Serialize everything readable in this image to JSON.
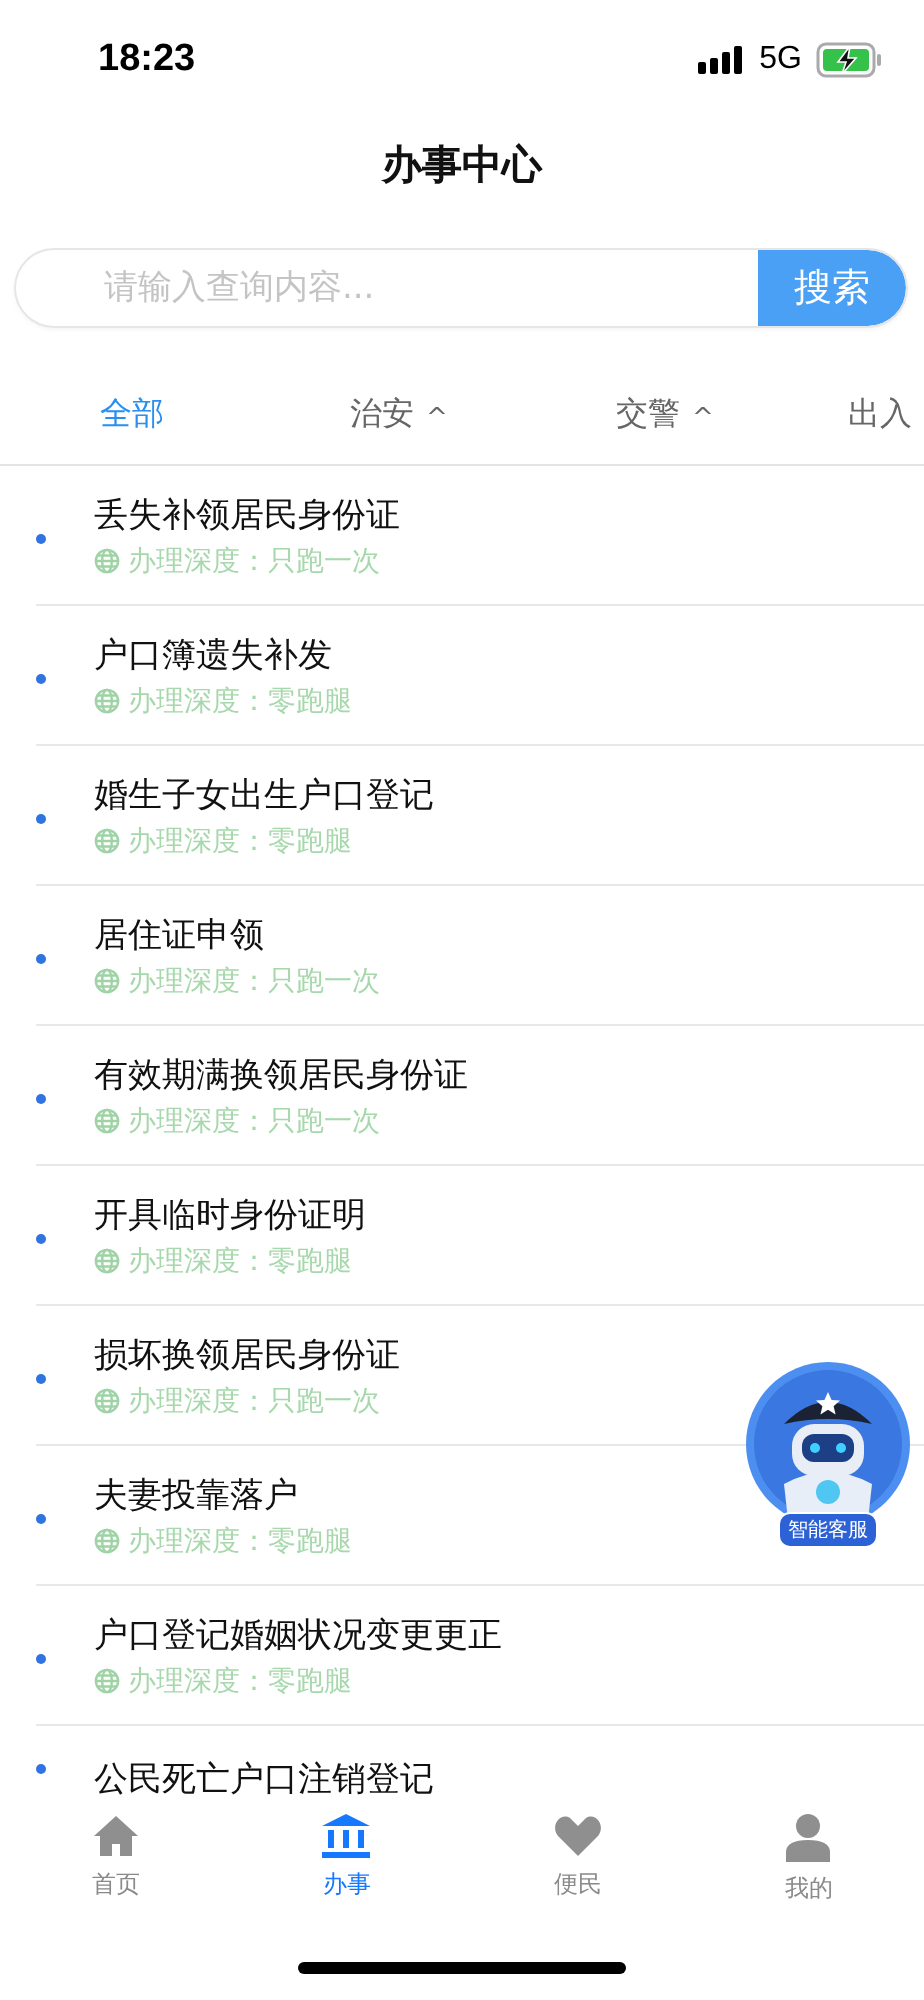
{
  "status_bar": {
    "time": "18:23",
    "network": "5G"
  },
  "header": {
    "title": "办事中心"
  },
  "search": {
    "placeholder": "请输入查询内容...",
    "button": "搜索"
  },
  "filters": [
    {
      "label": "全部",
      "selected": true,
      "has_menu": false
    },
    {
      "label": "治安",
      "selected": false,
      "has_menu": true
    },
    {
      "label": "交警",
      "selected": false,
      "has_menu": true
    },
    {
      "label": "出入",
      "selected": false,
      "has_menu": false
    }
  ],
  "caret": "^",
  "services": [
    {
      "title": "丢失补领居民身份证",
      "depth": "办理深度：只跑一次"
    },
    {
      "title": "户口簿遗失补发",
      "depth": "办理深度：零跑腿"
    },
    {
      "title": "婚生子女出生户口登记",
      "depth": "办理深度：零跑腿"
    },
    {
      "title": "居住证申领",
      "depth": "办理深度：只跑一次"
    },
    {
      "title": "有效期满换领居民身份证",
      "depth": "办理深度：只跑一次"
    },
    {
      "title": "开具临时身份证明",
      "depth": "办理深度：零跑腿"
    },
    {
      "title": "损坏换领居民身份证",
      "depth": "办理深度：只跑一次"
    },
    {
      "title": "夫妻投靠落户",
      "depth": "办理深度：零跑腿"
    },
    {
      "title": "户口登记婚姻状况变更更正",
      "depth": "办理深度：零跑腿"
    },
    {
      "title": "公民死亡户口注销登记"
    }
  ],
  "assistant": {
    "label": "智能客服"
  },
  "tab_bar": [
    {
      "label": "首页",
      "kind": "home",
      "selected": false
    },
    {
      "label": "办事",
      "kind": "bank",
      "selected": true
    },
    {
      "label": "便民",
      "kind": "heart",
      "selected": false
    },
    {
      "label": "我的",
      "kind": "person",
      "selected": false
    }
  ]
}
